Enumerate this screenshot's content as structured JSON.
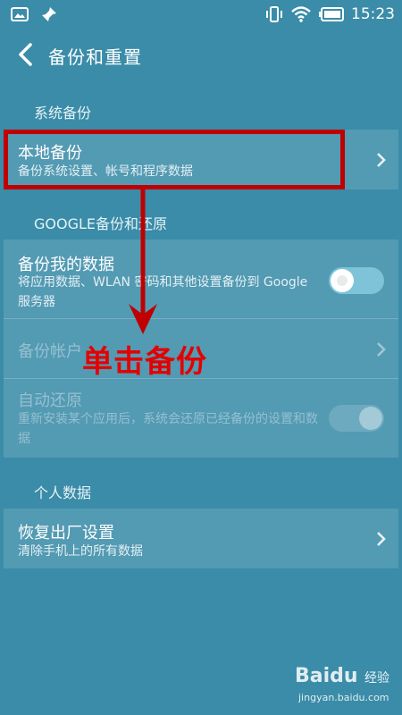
{
  "status_bar": {
    "time": "15:23",
    "left_icons": [
      "image-icon",
      "pin-icon"
    ],
    "right_icons": [
      "vibrate-icon",
      "wifi-icon",
      "battery-icon"
    ]
  },
  "app_bar": {
    "title": "备份和重置"
  },
  "sections": {
    "system_backup": {
      "header": "系统备份",
      "local_backup": {
        "title": "本地备份",
        "subtitle": "备份系统设置、帐号和程序数据"
      }
    },
    "google": {
      "header": "GOOGLE备份和还原",
      "backup_my_data": {
        "title": "备份我的数据",
        "subtitle": "将应用数据、WLAN 密码和其他设置备份到 Google 服务器",
        "toggle_on": false
      },
      "backup_account": {
        "title": "备份帐户"
      },
      "auto_restore": {
        "title": "自动还原",
        "subtitle": "重新安装某个应用后，系统会还原已经备份的设置和数据",
        "toggle_on": false
      }
    },
    "personal": {
      "header": "个人数据",
      "factory_reset": {
        "title": "恢复出厂设置",
        "subtitle": "清除手机上的所有数据"
      }
    }
  },
  "annotation": {
    "text": "单击备份",
    "color": "#e50000"
  },
  "watermark": {
    "logo": "Baidu",
    "label": "经验",
    "url": "jingyan.baidu.com"
  },
  "colors": {
    "background": "#3a8ca8",
    "toggle_track": "#7ec3d8",
    "highlight": "#c00000"
  }
}
